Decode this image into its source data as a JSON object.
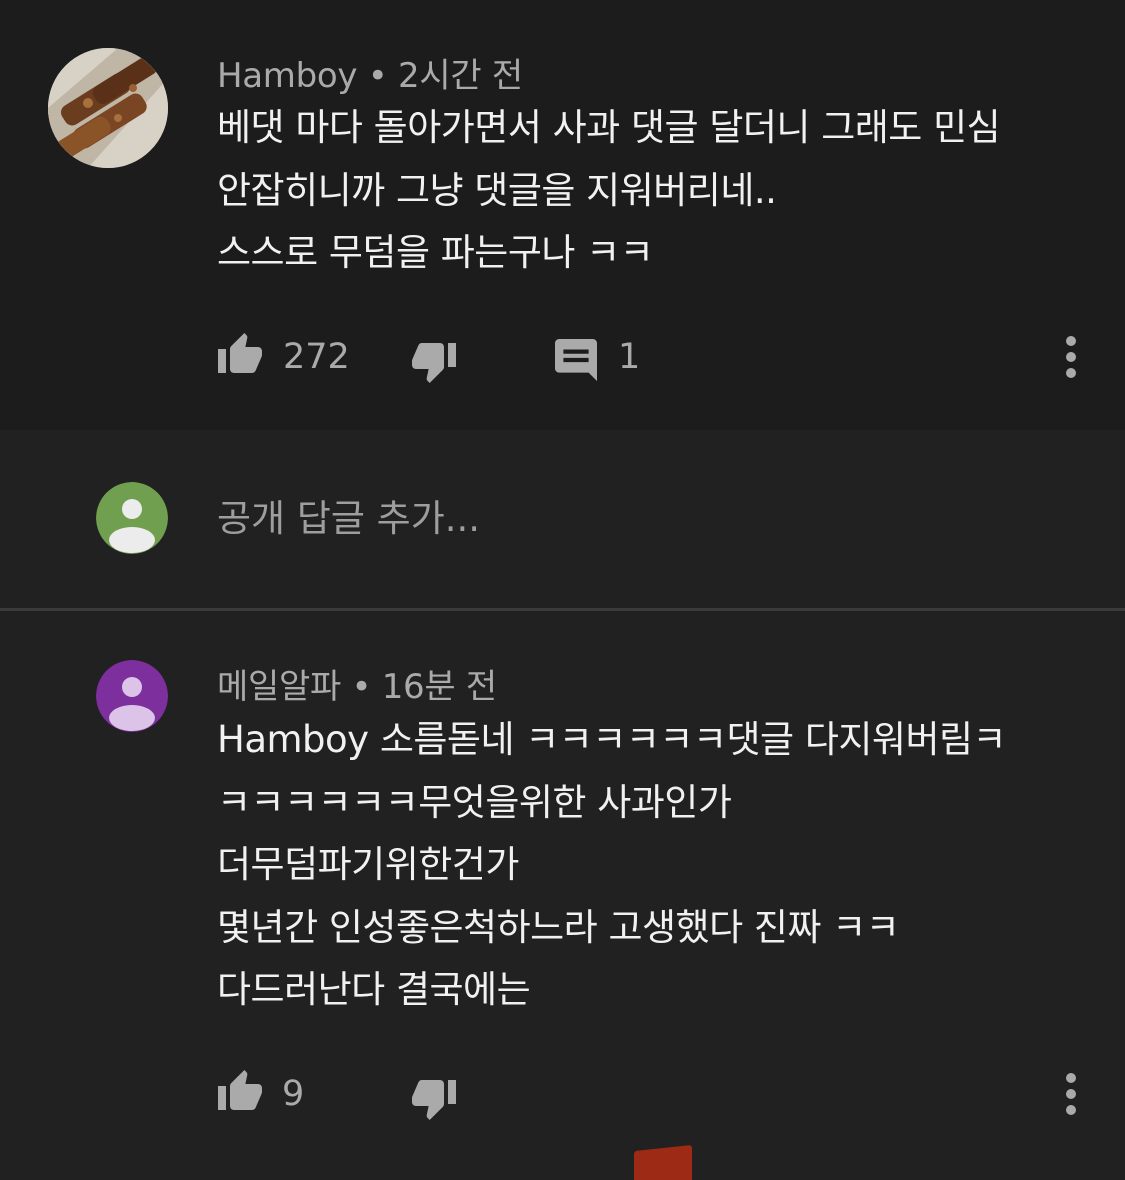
{
  "comments": [
    {
      "author": "Hamboy",
      "separator": "•",
      "time": "2시간 전",
      "lines": [
        "베댓 마다 돌아가면서 사과 댓글 달더니 그래도 민심",
        "안잡히니까 그냥 댓글을 지워버리네..",
        "스스로 무덤을 파는구나 ㅋㅋ"
      ],
      "likes": "272",
      "replies": "1"
    },
    {
      "author": "메일알파",
      "separator": "•",
      "time": "16분 전",
      "lines": [
        "Hamboy 소름돋네 ㅋㅋㅋㅋㅋㅋ댓글 다지워버림ㅋ",
        "ㅋㅋㅋㅋㅋㅋ무엇을위한 사과인가",
        "더무덤파기위한건가",
        "몇년간 인성좋은척하느라 고생했다 진짜 ㅋㅋ",
        "다드러난다 결국에는"
      ],
      "likes": "9"
    }
  ],
  "reply_box": {
    "placeholder": "공개 답글 추가..."
  },
  "icons": {
    "like": "thumbs-up-icon",
    "dislike": "thumbs-down-icon",
    "reply": "comment-icon",
    "more": "more-vert-icon"
  },
  "colors": {
    "avatar_green": "#6f9f4f",
    "avatar_purple": "#7e2f9e"
  }
}
